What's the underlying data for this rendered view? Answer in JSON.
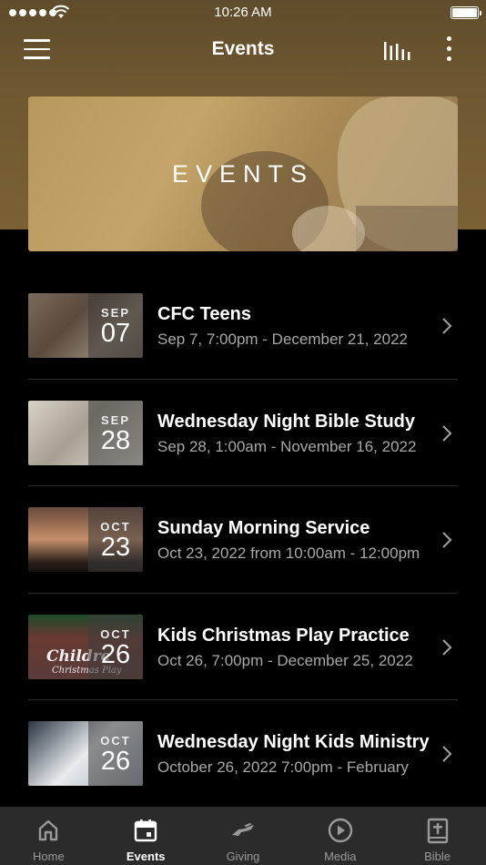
{
  "status_bar": {
    "time": "10:26 AM"
  },
  "nav": {
    "title": "Events"
  },
  "banner": {
    "title": "EVENTS"
  },
  "events": [
    {
      "month": "SEP",
      "day": "07",
      "title": "CFC Teens",
      "subtitle": "Sep 7, 7:00pm - December 21, 2022"
    },
    {
      "month": "SEP",
      "day": "28",
      "title": "Wednesday Night Bible Study",
      "subtitle": "Sep 28, 1:00am - November 16, 2022"
    },
    {
      "month": "OCT",
      "day": "23",
      "title": "Sunday Morning Service",
      "subtitle": "Oct 23, 2022 from 10:00am - 12:00pm"
    },
    {
      "month": "OCT",
      "day": "26",
      "title": "Kids Christmas Play Practice",
      "subtitle": "Oct 26, 7:00pm - December 25, 2022",
      "thumb_text": "Childre",
      "thumb_text2": "Christmas Play"
    },
    {
      "month": "OCT",
      "day": "26",
      "title": "Wednesday Night Kids Ministry",
      "subtitle": "October 26, 2022 7:00pm - February"
    }
  ],
  "tabs": [
    {
      "label": "Home",
      "icon": "home-icon"
    },
    {
      "label": "Events",
      "icon": "calendar-icon",
      "active": true
    },
    {
      "label": "Giving",
      "icon": "giving-hand-icon"
    },
    {
      "label": "Media",
      "icon": "play-circle-icon"
    },
    {
      "label": "Bible",
      "icon": "bible-icon"
    }
  ],
  "colors": {
    "header_bg": "#6f5731",
    "background": "#000000",
    "tab_bar_bg": "#2b2b2b",
    "subtitle_gray": "#a8a8a8"
  }
}
